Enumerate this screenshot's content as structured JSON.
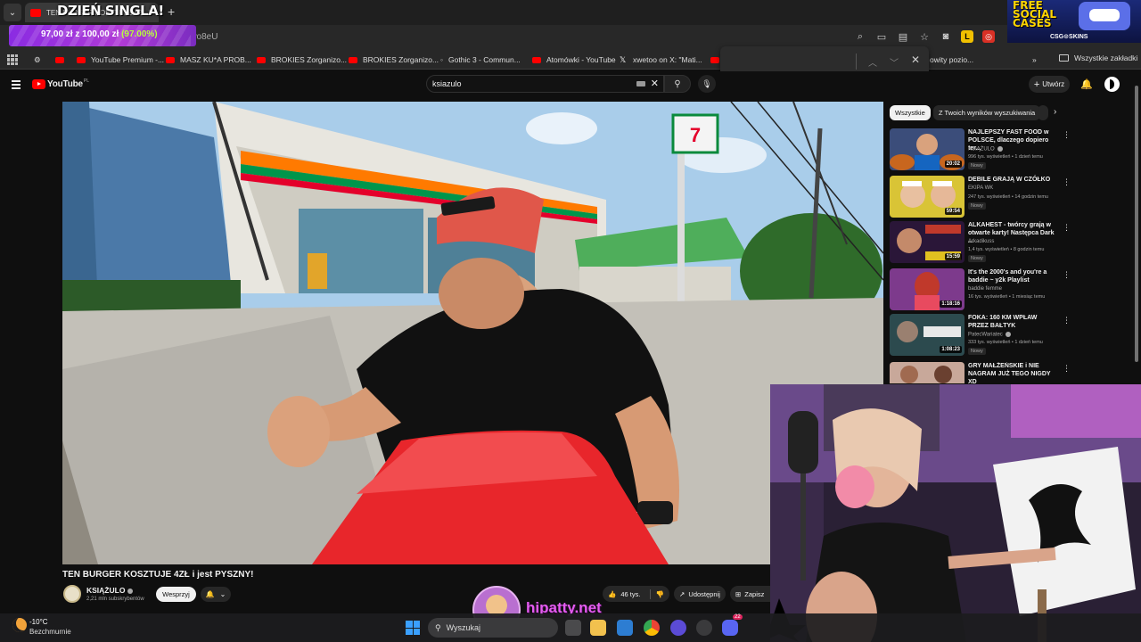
{
  "browser": {
    "tab_title": "TEN BURGER KOSZTUJE 4ZŁ i jest PYSZNY! - YouTube",
    "tab_close": "×",
    "new_tab": "+",
    "url_fragment": "YEwo8eU",
    "bookmarks": [
      {
        "label": "YouTube Premium -...",
        "icon": "youtube"
      },
      {
        "label": "MASZ KU*A PROB...",
        "icon": "youtube"
      },
      {
        "label": "BROKIES Zorganizo...",
        "icon": "youtube"
      },
      {
        "label": "BROKIES Zorganizo...",
        "icon": "youtube"
      },
      {
        "label": "Gothic 3 - Commun...",
        "icon": "link"
      },
      {
        "label": "Atomówki - YouTube",
        "icon": "youtube"
      },
      {
        "label": "xwetoo on X: \"Mati...",
        "icon": "x"
      },
      {
        "label": "owity pozio...",
        "icon": "link"
      }
    ],
    "more_bookmarks": "»",
    "all_bookmarks": "Wszystkie zakładki"
  },
  "youtube": {
    "logo_text": "YouTube",
    "logo_region": "PL",
    "search_query": "ksiazulo",
    "create_label": "Utwórz",
    "video": {
      "title": "TEN BURGER KOSZTUJE 4ZŁ i jest PYSZNY!",
      "channel": "KSIĄŻULO",
      "subscribers": "2,21 mln subskrybentów",
      "support_label": "Wesprzyj",
      "likes": "46 tys.",
      "share_label": "Udostępnij",
      "save_label": "Zapisz"
    },
    "chips": [
      "Wszystkie",
      "Z Twoich wyników wyszukiwania"
    ],
    "recommendations": [
      {
        "title": "NAJLEPSZY FAST FOOD w POLSCE, dlaczego dopiero ter...",
        "channel": "KSIĄŻULO",
        "meta": "996 tys. wyświetleń • 1 dzień temu",
        "badge": "Nowy",
        "duration": "20:02",
        "thumb_color": "#3b4d7a"
      },
      {
        "title": "DEBILE GRAJĄ W CZÓŁKO",
        "channel": "EKIPA WK",
        "meta": "247 tys. wyświetleń • 14 godzin temu",
        "badge": "Nowy",
        "duration": "59:54",
        "thumb_color": "#d9c436"
      },
      {
        "title": "ALKAHEST - twórcy grają w otwarte karty! Następca Dark ...",
        "channel": "Arkadikuss",
        "meta": "1,4 tys. wyświetleń • 8 godzin temu",
        "badge": "Nowy",
        "duration": "15:59",
        "thumb_color": "#2a1638"
      },
      {
        "title": "It's the 2000's and you're a baddie ~ y2k Playlist",
        "channel": "baddie femme",
        "meta": "16 tys. wyświetleń • 1 miesiąc temu",
        "badge": "",
        "duration": "1:18:16",
        "thumb_color": "#7d3a8c"
      },
      {
        "title": "FOKA: 160 KM WPŁAW PRZEZ BAŁTYK",
        "channel": "PatecWariatec",
        "meta": "333 tys. wyświetleń • 1 dzień temu",
        "badge": "Nowy",
        "duration": "1:08:23",
        "thumb_color": "#2c4a4e"
      },
      {
        "title": "GRY MAŁŻEŃSKIE i NIE NAGRAM JUŻ TEGO NIGDY XD",
        "channel": "",
        "meta": "",
        "badge": "",
        "duration": "",
        "thumb_color": "#c8a89a"
      }
    ]
  },
  "overlays": {
    "single_title": "DZIEŃ SINGLA!",
    "donation_amount": "97,00 zł z 100,00 zł",
    "donation_percent": "(97.00%)",
    "donation_progress": 0.97,
    "ad_line1": "FREE",
    "ad_line2": "SOCIAL",
    "ad_line3": "CASES",
    "ad_brand": "CSG⊙SKINS",
    "streamer_handle": "hipatty.net"
  },
  "taskbar": {
    "temperature": "-10°C",
    "weather": "Bezchmurnie",
    "search_placeholder": "Wyszukaj",
    "discord_badge": "22"
  }
}
